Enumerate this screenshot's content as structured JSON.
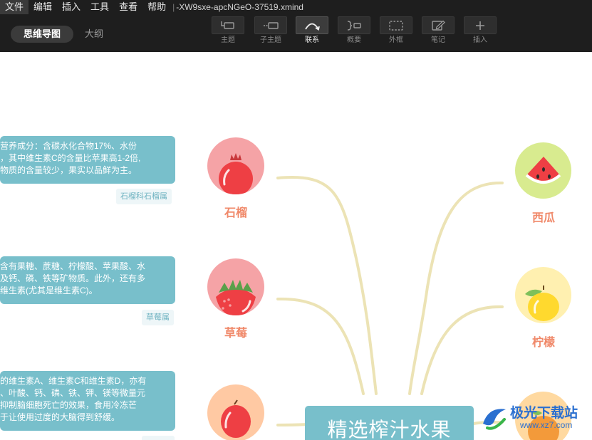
{
  "menubar": {
    "items": [
      "文件",
      "编辑",
      "插入",
      "工具",
      "查看",
      "帮助"
    ],
    "separator": "|",
    "filename": "-XW9sxe-apcNGeO-37519.xmind"
  },
  "view": {
    "mindmap": "思维导图",
    "outline": "大纲"
  },
  "toolbar": {
    "items": [
      {
        "label": "主题",
        "icon": "topic-icon"
      },
      {
        "label": "子主题",
        "icon": "subtopic-icon"
      },
      {
        "label": "联系",
        "icon": "relationship-icon"
      },
      {
        "label": "概要",
        "icon": "summary-icon"
      },
      {
        "label": "外框",
        "icon": "boundary-icon"
      },
      {
        "label": "笔记",
        "icon": "note-icon"
      },
      {
        "label": "插入",
        "icon": "plus-icon"
      }
    ],
    "active_index": 2
  },
  "central": {
    "title": "精选榨汁水果"
  },
  "notes": [
    {
      "lines": [
        "营养成分：含碳水化合物17%、水份",
        "，其中维生素C的含量比苹果高1-2倍,",
        "物质的含量较少，果实以品鲜为主。"
      ],
      "tag": "石榴科石榴属"
    },
    {
      "lines": [
        "含有果糖、蔗糖、柠檬酸、苹果酸、水",
        "及钙、磷、铁等矿物质。此外，还有多",
        "维生素(尤其是维生素C)。"
      ],
      "tag": "草莓属"
    },
    {
      "lines": [
        "的维生素A、维生素C和维生素D，亦有",
        "、叶酸、钙、磷、铁、钾、镁等微量元",
        "抑制脑细胞死亡的效果，食用冷冻芒",
        "于让使用过度的大脑得到舒缓。"
      ],
      "tag": ""
    }
  ],
  "fruits": {
    "left": [
      {
        "name": "石榴",
        "icon": "pomegranate-icon",
        "bg": "#f5a3a6"
      },
      {
        "name": "草莓",
        "icon": "strawberry-icon",
        "bg": "#f5a3a6"
      },
      {
        "name": "",
        "icon": "mango-icon",
        "bg": "#ffc9a3"
      }
    ],
    "right": [
      {
        "name": "西瓜",
        "icon": "watermelon-icon",
        "bg": "#d8eb8f"
      },
      {
        "name": "柠檬",
        "icon": "lemon-icon",
        "bg": "#fff0b0"
      },
      {
        "name": "",
        "icon": "orange-icon",
        "bg": "#ffd9a0"
      }
    ]
  },
  "colors": {
    "toolbar_bg": "#1e1e1e",
    "note_bg": "#78bfcb",
    "fruit_label": "#f0896a",
    "connector": "#ece3b5"
  },
  "watermark": {
    "title": "极光下载站",
    "url": "www.xz7.com"
  }
}
